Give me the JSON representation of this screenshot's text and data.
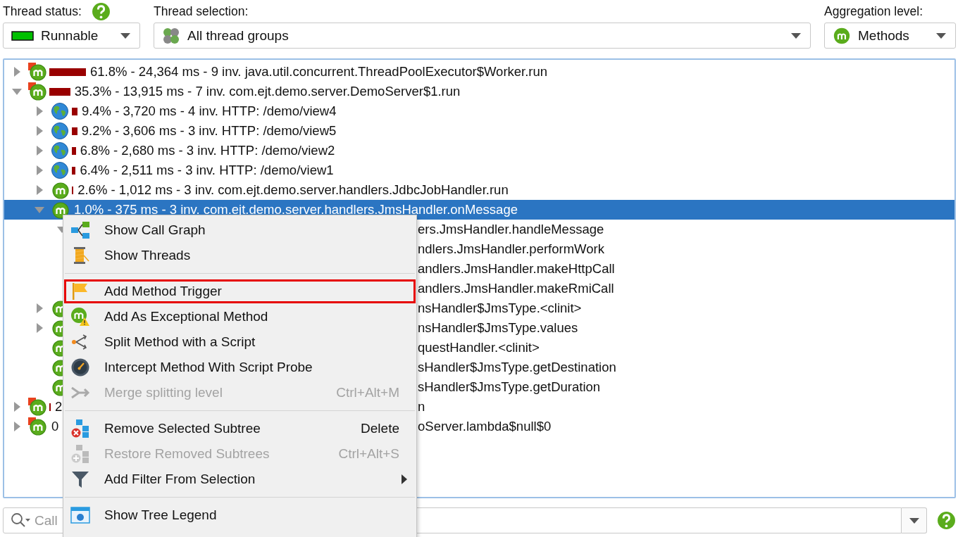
{
  "filters": [
    {
      "kind": "status",
      "label": "Thread status:",
      "help": true,
      "value": "Runnable"
    },
    {
      "kind": "groups",
      "label": "Thread selection:",
      "value": "All thread groups"
    },
    {
      "kind": "method",
      "label": "Aggregation level:",
      "value": "Methods"
    }
  ],
  "tree": {
    "rows": [
      {
        "kind": "entry",
        "expanded": false,
        "selected": false,
        "covered": false,
        "level": 0.618,
        "text": "61.8% - 24,364 ms - 9 inv. java.util.concurrent.ThreadPoolExecutor$Worker.run"
      },
      {
        "kind": "entry",
        "expanded": true,
        "selected": false,
        "covered": false,
        "level": 0.353,
        "text": "35.3% - 13,915 ms - 7 inv. com.ejt.demo.server.DemoServer$1.run",
        "children": [
          {
            "kind": "http",
            "expanded": false,
            "selected": false,
            "covered": false,
            "level": 0.094,
            "text": "9.4% - 3,720 ms - 4 inv. HTTP: /demo/view4"
          },
          {
            "kind": "http",
            "expanded": false,
            "selected": false,
            "covered": false,
            "level": 0.092,
            "text": "9.2% - 3,606 ms - 3 inv. HTTP: /demo/view5"
          },
          {
            "kind": "http",
            "expanded": false,
            "selected": false,
            "covered": false,
            "level": 0.068,
            "text": "6.8% - 2,680 ms - 3 inv. HTTP: /demo/view2"
          },
          {
            "kind": "http",
            "expanded": false,
            "selected": false,
            "covered": false,
            "level": 0.064,
            "text": "6.4% - 2,511 ms - 3 inv. HTTP: /demo/view1"
          },
          {
            "kind": "method",
            "expanded": false,
            "selected": false,
            "covered": false,
            "level": 0.026,
            "text": "2.6% - 1,012 ms - 3 inv. com.ejt.demo.server.handlers.JdbcJobHandler.run"
          },
          {
            "kind": "method",
            "expanded": true,
            "selected": true,
            "covered": false,
            "text": "1.0% - 375 ms - 3 inv. com.ejt.demo.server.handlers.JmsHandler.onMessage",
            "children": [
              {
                "expanded": true,
                "selected": false,
                "covered": true,
                "text": "ers.JmsHandler.handleMessage",
                "children": [
                  {
                    "selected": false,
                    "covered": true,
                    "text": "ndlers.JmsHandler.performWork"
                  },
                  {
                    "selected": false,
                    "covered": true,
                    "text": "andlers.JmsHandler.makeHttpCall"
                  },
                  {
                    "selected": false,
                    "covered": true,
                    "text": "andlers.JmsHandler.makeRmiCall"
                  }
                ]
              }
            ]
          },
          {
            "kind": "method",
            "expanded": false,
            "selected": false,
            "covered": true,
            "text": "nsHandler$JmsType.<clinit>"
          },
          {
            "kind": "method",
            "expanded": false,
            "selected": false,
            "covered": true,
            "text": "nsHandler$JmsType.values"
          },
          {
            "kind": "method",
            "selected": false,
            "covered": true,
            "text": "questHandler.<clinit>"
          },
          {
            "kind": "method",
            "selected": false,
            "covered": true,
            "text": "sHandler$JmsType.getDestination"
          },
          {
            "kind": "method",
            "selected": false,
            "covered": true,
            "text": "sHandler$JmsType.getDuration"
          }
        ]
      },
      {
        "kind": "entry",
        "expanded": false,
        "selected": false,
        "covered": true,
        "level": 0.02,
        "lead": "2",
        "text": "n"
      },
      {
        "kind": "entry",
        "expanded": false,
        "selected": false,
        "covered": true,
        "lead": "0",
        "text": "oServer.lambda$null$0"
      }
    ]
  },
  "context_menu": {
    "items": [
      {
        "kind": "call-graph",
        "label": "Show Call Graph",
        "disabled": false,
        "highlighted": false
      },
      {
        "kind": "threads",
        "label": "Show Threads",
        "disabled": false,
        "highlighted": false
      },
      {
        "kind": "separator"
      },
      {
        "kind": "flag",
        "label": "Add Method Trigger",
        "disabled": false,
        "highlighted": true
      },
      {
        "kind": "exceptional",
        "label": "Add As Exceptional Method",
        "disabled": false,
        "highlighted": false
      },
      {
        "kind": "split",
        "label": "Split Method with a Script",
        "disabled": false,
        "highlighted": false
      },
      {
        "kind": "probe",
        "label": "Intercept Method With Script Probe",
        "disabled": false,
        "highlighted": false
      },
      {
        "kind": "merge",
        "label": "Merge splitting level",
        "disabled": true,
        "highlighted": false,
        "shortcut": "Ctrl+Alt+M"
      },
      {
        "kind": "separator"
      },
      {
        "kind": "remove",
        "label": "Remove Selected Subtree",
        "disabled": false,
        "highlighted": false,
        "shortcut": "Delete"
      },
      {
        "kind": "restore",
        "label": "Restore Removed Subtrees",
        "disabled": true,
        "highlighted": false,
        "shortcut": "Ctrl+Alt+S"
      },
      {
        "kind": "filter",
        "label": "Add Filter From Selection",
        "disabled": false,
        "highlighted": false,
        "submenu": true
      },
      {
        "kind": "separator"
      },
      {
        "kind": "legend",
        "label": "Show Tree Legend",
        "disabled": false,
        "highlighted": false
      }
    ]
  },
  "search": {
    "placeholder": "Call",
    "help": true
  }
}
